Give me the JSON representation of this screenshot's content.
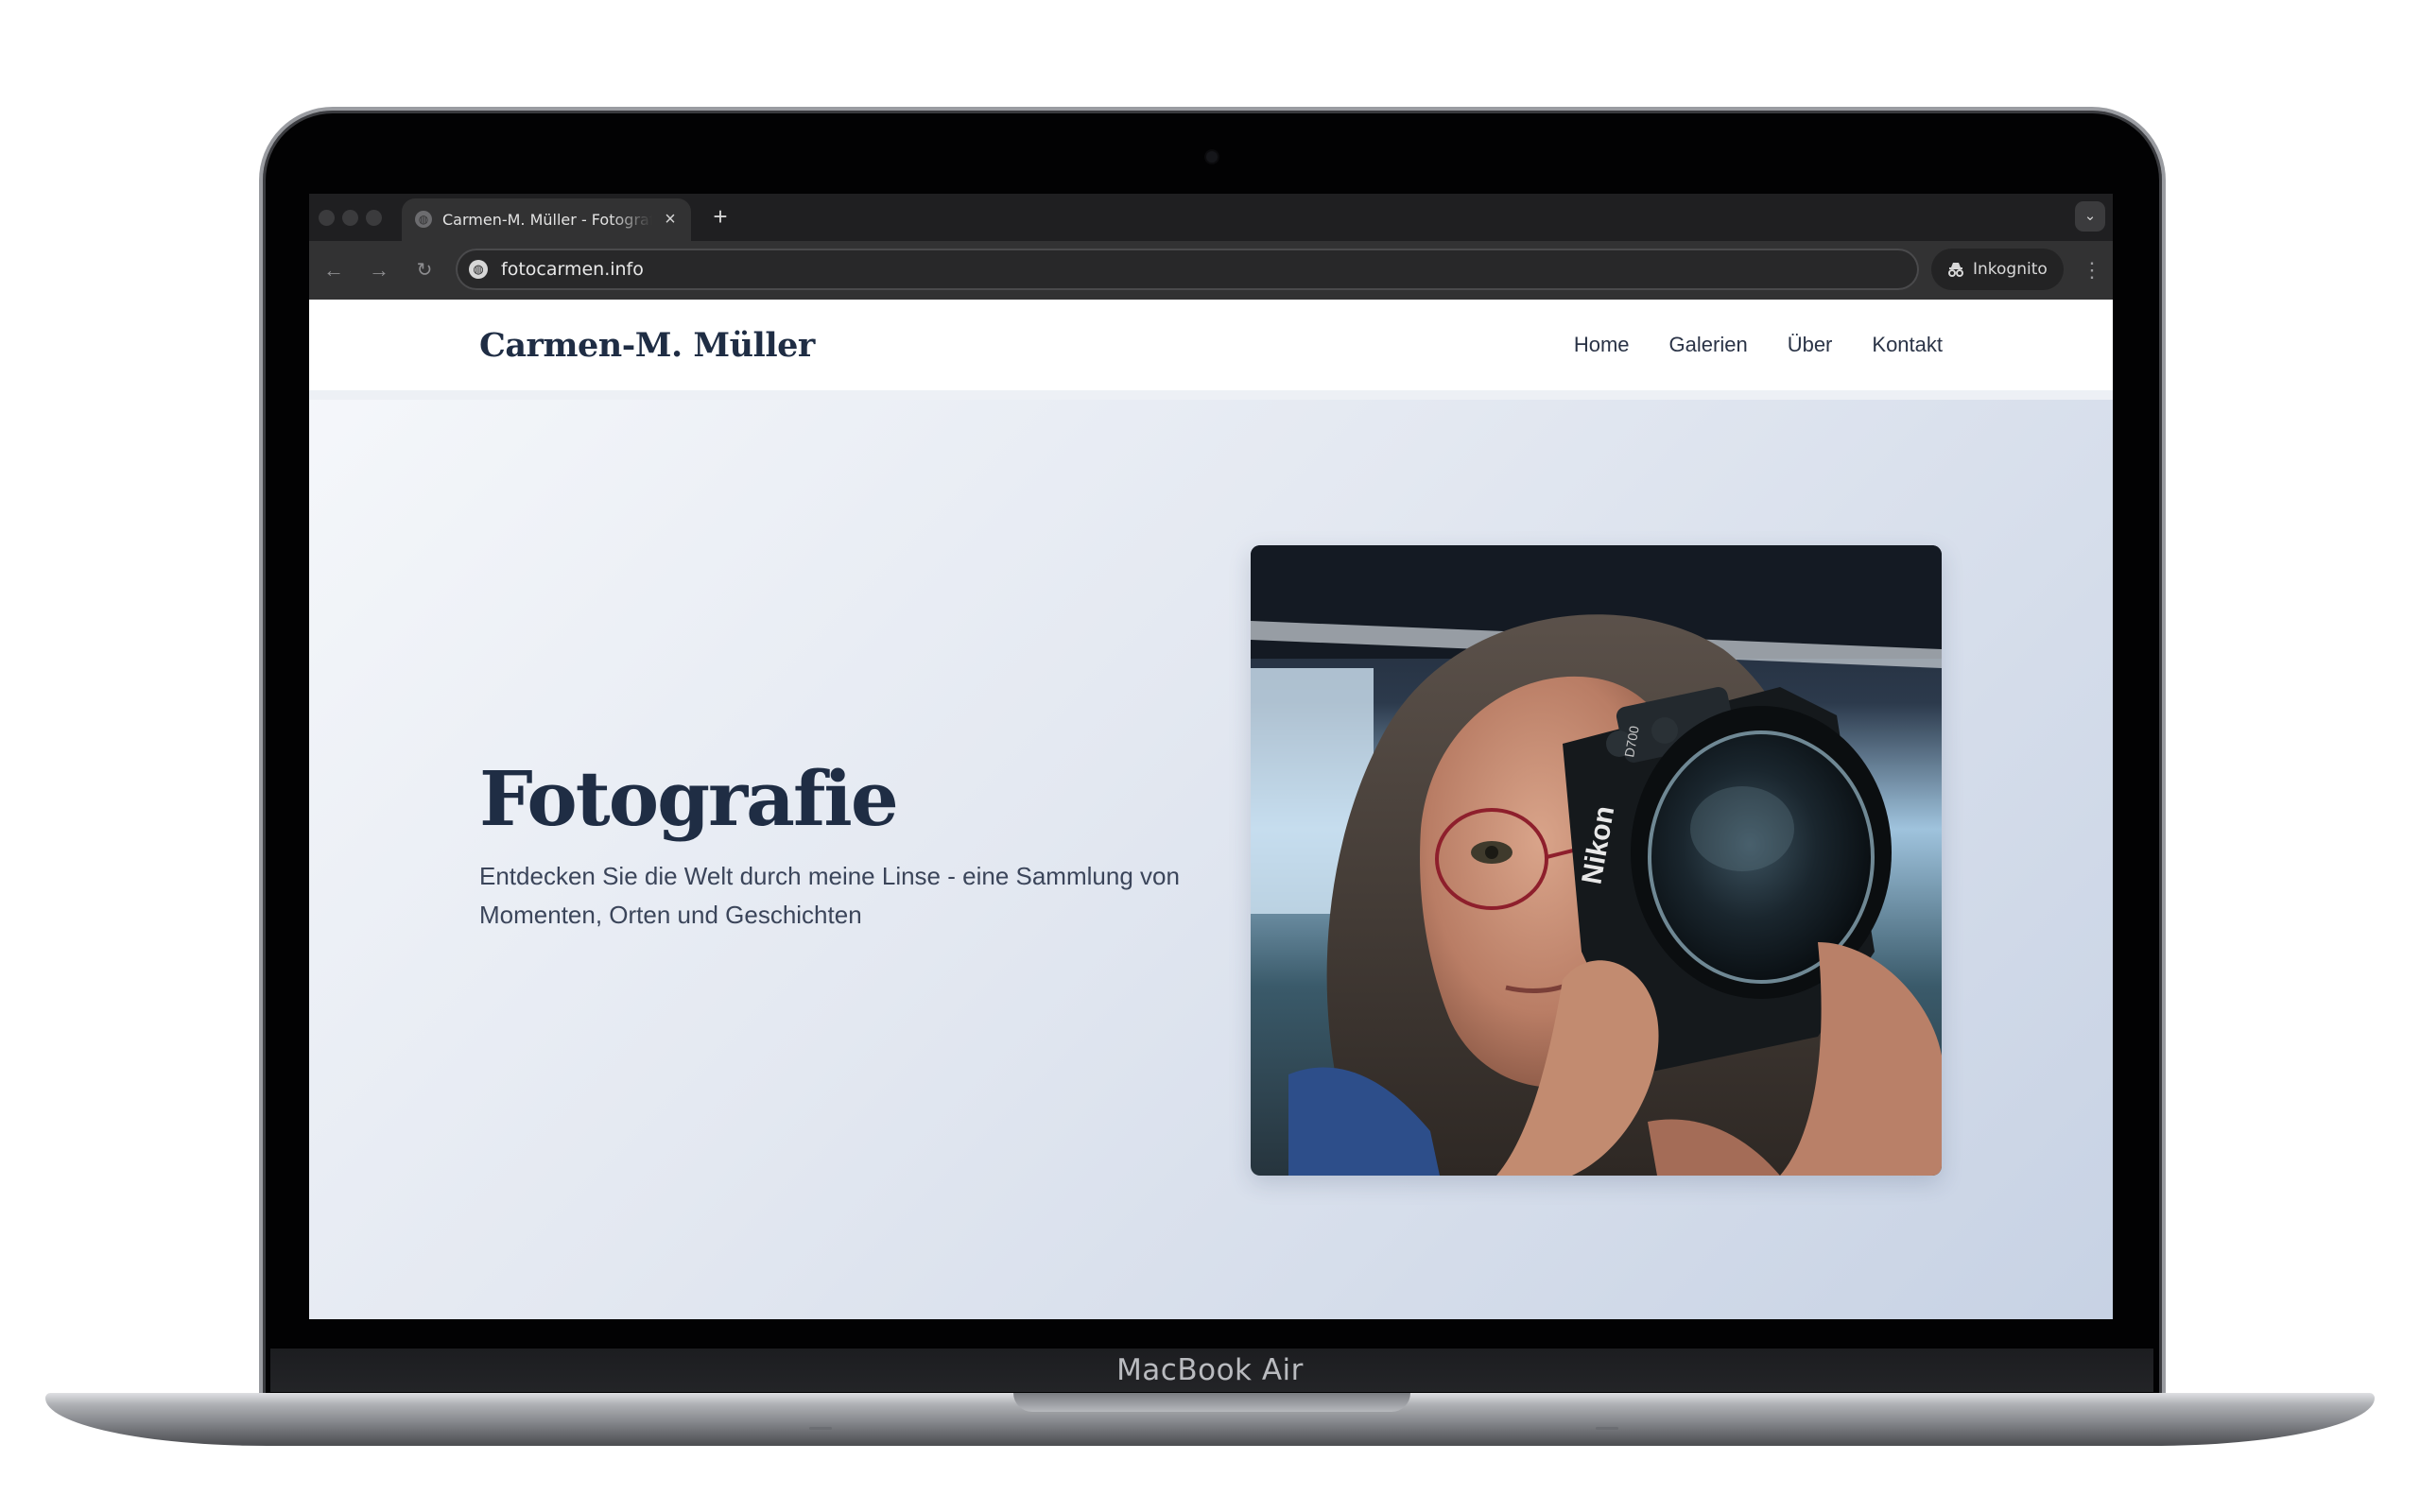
{
  "browser": {
    "tab_title": "Carmen-M. Müller - Fotografie",
    "new_tab_symbol": "+",
    "url": "fotocarmen.info",
    "incognito_label": "Inkognito"
  },
  "site": {
    "logo": "Carmen-M. Müller",
    "nav": [
      "Home",
      "Galerien",
      "Über",
      "Kontakt"
    ]
  },
  "hero": {
    "title": "Fotografie",
    "subtitle": "Entdecken Sie die Welt durch meine Linse - eine Sammlung von Momenten, Orten und Geschichten",
    "image": "portrait of a woman holding a camera",
    "camera_brand": "Nikon",
    "camera_model": "D700"
  },
  "device": {
    "label": "MacBook Air"
  },
  "icons": {
    "favicon": "globe-icon",
    "close": "close-icon",
    "back": "arrow-left-icon",
    "forward": "arrow-right-icon",
    "reload": "reload-icon",
    "site_info": "site-info-icon",
    "incognito": "incognito-icon",
    "menu": "kebab-menu-icon",
    "tab_search": "chevron-down-icon"
  },
  "colors": {
    "heading": "#1f2d44",
    "browser_dark": "#1f1f21",
    "toolbar": "#323233",
    "hero_gradient_start": "#f6f8fb",
    "hero_gradient_end": "#c7d2e4"
  }
}
